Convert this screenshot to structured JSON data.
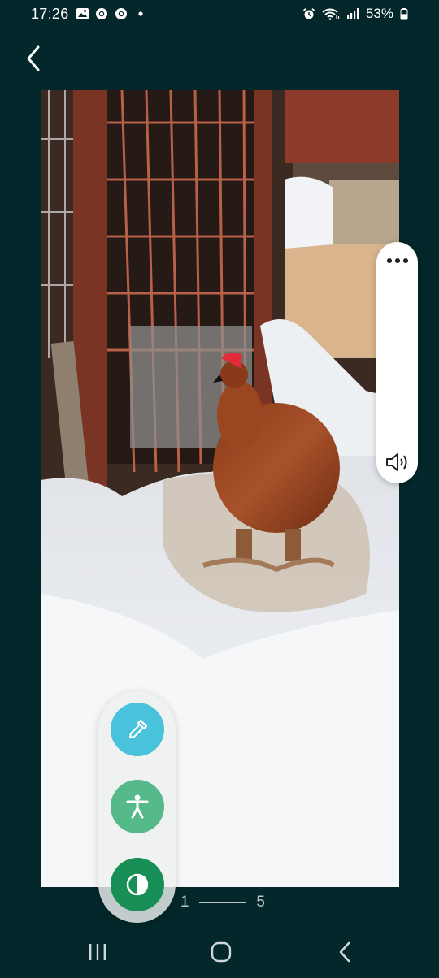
{
  "status_bar": {
    "time": "17:26",
    "notification_icons": [
      "gallery-icon",
      "chrome-icon",
      "chrome-icon",
      "dot-icon"
    ],
    "system_icons": [
      "alarm-icon",
      "wifi-icon",
      "signal-icon"
    ],
    "battery_percent": "53%",
    "battery_level": 0.53
  },
  "viewer": {
    "back_icon": "chevron-left-icon",
    "pager": {
      "current": "1",
      "total": "5"
    }
  },
  "volume_panel": {
    "more_icon": "more-horizontal-icon",
    "volume_icon": "volume-icon"
  },
  "accessibility_panel": {
    "buttons": [
      {
        "icon": "eyedropper-icon",
        "color": "#49c2dc"
      },
      {
        "icon": "accessibility-icon",
        "color": "#55b98a"
      },
      {
        "icon": "contrast-icon",
        "color": "#178f56"
      }
    ]
  },
  "nav_bar": {
    "recent_icon": "recent-apps-icon",
    "home_icon": "home-icon",
    "back_icon": "back-icon"
  },
  "colors": {
    "background": "#03272a",
    "panel": "#ffffff"
  }
}
